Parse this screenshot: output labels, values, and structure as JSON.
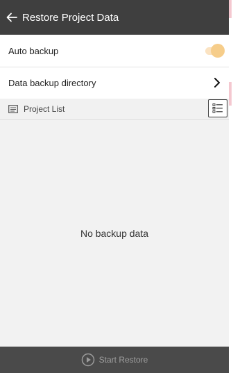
{
  "header": {
    "title": "Restore Project Data",
    "back_icon": "arrow-left-icon"
  },
  "settings": {
    "auto_backup": {
      "label": "Auto backup",
      "enabled": true
    },
    "backup_directory": {
      "label": "Data backup directory",
      "icon": "chevron-right-icon"
    }
  },
  "project_list": {
    "label": "Project List",
    "icon": "list-folder-icon",
    "action_icon": "list-view-icon"
  },
  "empty_state": {
    "message": "No backup data"
  },
  "footer": {
    "start_label": "Start Restore",
    "start_icon": "play-circle-icon",
    "enabled": false
  },
  "colors": {
    "topbar": "#3f3f3f",
    "accent": "#f6cd8a",
    "footer": "#4a4a4a"
  }
}
